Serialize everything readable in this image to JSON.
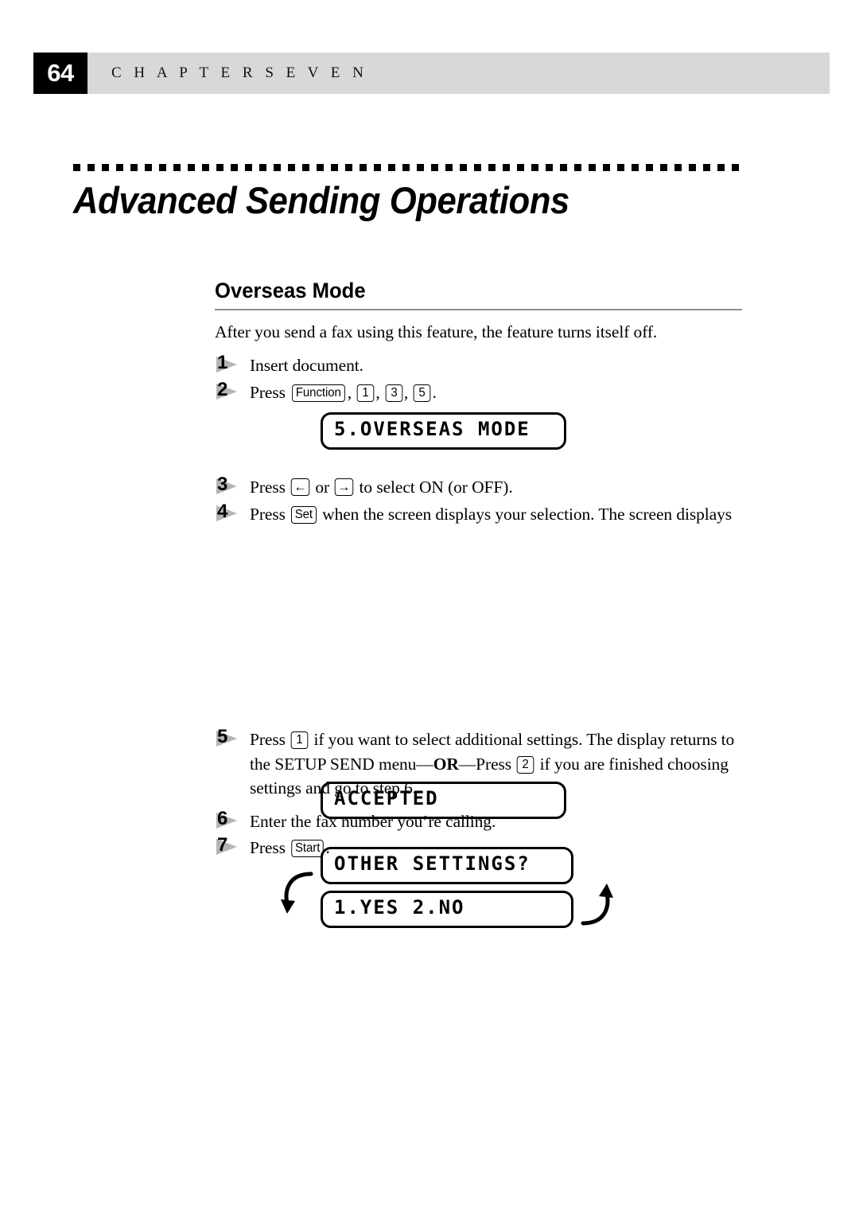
{
  "header": {
    "page_number": "64",
    "chapter_label": "C H A P T E R   S E V E N"
  },
  "title": {
    "text": "Advanced Sending Operations"
  },
  "section": {
    "heading": "Overseas Mode",
    "intro": "After you send a fax using this feature, the feature turns itself off."
  },
  "steps": [
    {
      "number": "1",
      "text_before": "Insert document.",
      "keys": []
    },
    {
      "number": "2",
      "text_before": "Press ",
      "keys": [
        "Function",
        "1",
        "3",
        "5"
      ],
      "text_after": "."
    },
    {
      "number": "3",
      "text_before": "Press ",
      "key_left": "←",
      "text_middle": " or ",
      "key_right": "→",
      "text_after": " to select ON (or OFF)."
    },
    {
      "number": "4",
      "text_before": "Press ",
      "key": "Set",
      "text_after": " when the screen displays your selection. The screen displays"
    },
    {
      "number": "5",
      "part_1": "Press ",
      "key_1": "1",
      "part_2": " if you want to select additional settings. The display returns to the SETUP SEND menu—",
      "or_label": "OR",
      "part_3": "—Press ",
      "key_2": "2",
      "part_4": " if you are finished choosing settings and go to step 6."
    },
    {
      "number": "6",
      "text_before": "Enter the fax number you’re calling.",
      "keys": []
    },
    {
      "number": "7",
      "text_before": "Press ",
      "key": "Start",
      "text_after": "."
    }
  ],
  "displays": {
    "overseas_mode": "5.OVERSEAS MODE",
    "accepted": "ACCEPTED",
    "other_settings": "OTHER SETTINGS?",
    "yes_no": "1.YES 2.NO"
  },
  "icons": {
    "cycle_arrow_left": "cycle-arrow-left-icon",
    "cycle_arrow_right": "cycle-arrow-right-icon"
  },
  "colors": {
    "header_band": "#d8d8d8",
    "page_block": "#000000",
    "rule": "#8d8d8d",
    "step_flag": "#b5b5b5"
  }
}
